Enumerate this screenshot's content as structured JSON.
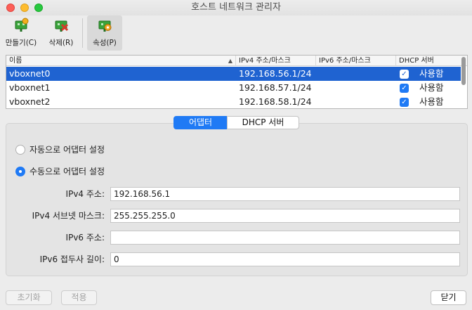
{
  "window": {
    "title": "호스트 네트워크 관리자"
  },
  "toolbar": {
    "create_label": "만들기(C)",
    "remove_label": "삭제(R)",
    "properties_label": "속성(P)"
  },
  "table": {
    "headers": {
      "name": "이름",
      "ipv4": "IPv4 주소/마스크",
      "ipv6": "IPv6 주소/마스크",
      "dhcp": "DHCP 서버"
    },
    "rows": [
      {
        "name": "vboxnet0",
        "ipv4": "192.168.56.1/24",
        "ipv6": "",
        "dhcp": "사용함",
        "selected": true
      },
      {
        "name": "vboxnet1",
        "ipv4": "192.168.57.1/24",
        "ipv6": "",
        "dhcp": "사용함",
        "selected": false
      },
      {
        "name": "vboxnet2",
        "ipv4": "192.168.58.1/24",
        "ipv6": "",
        "dhcp": "사용함",
        "selected": false
      }
    ]
  },
  "tabs": {
    "adapter": "어댑터",
    "dhcp": "DHCP 서버"
  },
  "adapter": {
    "auto_label": "자동으로 어댑터 설정",
    "manual_label": "수동으로 어댑터 설정",
    "ipv4_label": "IPv4 주소:",
    "ipv4_value": "192.168.56.1",
    "mask_label": "IPv4 서브넷 마스크:",
    "mask_value": "255.255.255.0",
    "ipv6_label": "IPv6 주소:",
    "ipv6_value": "",
    "prefix_label": "IPv6 접두사 길이:",
    "prefix_value": "0"
  },
  "buttons": {
    "reset": "초기화",
    "apply": "적용",
    "close": "닫기"
  },
  "colors": {
    "accent": "#1f7af5",
    "selection": "#1f63d1"
  }
}
